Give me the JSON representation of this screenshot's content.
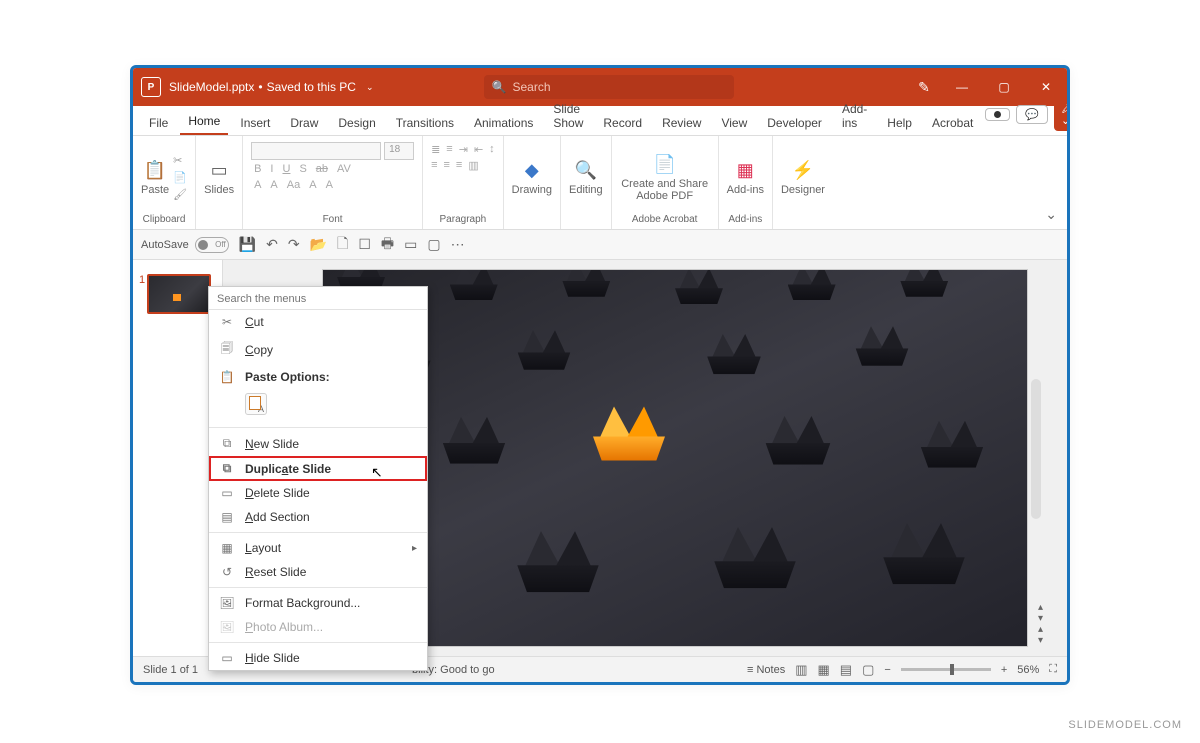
{
  "titlebar": {
    "app_initial": "P",
    "filename": "SlideModel.pptx",
    "saved": "Saved to this PC",
    "search_placeholder": "Search"
  },
  "tabs": {
    "items": [
      "File",
      "Home",
      "Insert",
      "Draw",
      "Design",
      "Transitions",
      "Animations",
      "Slide Show",
      "Record",
      "Review",
      "View",
      "Developer",
      "Add-ins",
      "Help",
      "Acrobat"
    ],
    "active": "Home"
  },
  "ribbon": {
    "clipboard": {
      "paste": "Paste",
      "group": "Clipboard"
    },
    "slides": {
      "label": "Slides"
    },
    "font": {
      "group": "Font",
      "size": "18",
      "buttons": [
        "B",
        "I",
        "U",
        "S",
        "ab",
        "AV"
      ],
      "row2": [
        "A",
        "A",
        "Aa",
        "A",
        "A"
      ]
    },
    "paragraph": {
      "group": "Paragraph"
    },
    "drawing": {
      "label": "Drawing"
    },
    "editing": {
      "label": "Editing"
    },
    "acrobat": {
      "label": "Create and Share Adobe PDF",
      "group": "Adobe Acrobat"
    },
    "addins": {
      "label": "Add-ins",
      "group": "Add-ins"
    },
    "designer": {
      "label": "Designer"
    }
  },
  "qat": {
    "autosave": "AutoSave",
    "off": "Off"
  },
  "thumb": {
    "num": "1"
  },
  "contextmenu": {
    "search_placeholder": "Search the menus",
    "cut": "Cut",
    "copy": "Copy",
    "paste_options": "Paste Options:",
    "new_slide": "New Slide",
    "duplicate_slide": "Duplicate Slide",
    "delete_slide": "Delete Slide",
    "add_section": "Add Section",
    "layout": "Layout",
    "reset_slide": "Reset Slide",
    "format_bg": "Format Background...",
    "photo_album": "Photo Album...",
    "hide_slide": "Hide Slide"
  },
  "statusbar": {
    "slide": "Slide 1 of 1",
    "accessibility": "bility: Good to go",
    "notes": "Notes",
    "zoom": "56%"
  },
  "watermark": "SLIDEMODEL.COM"
}
